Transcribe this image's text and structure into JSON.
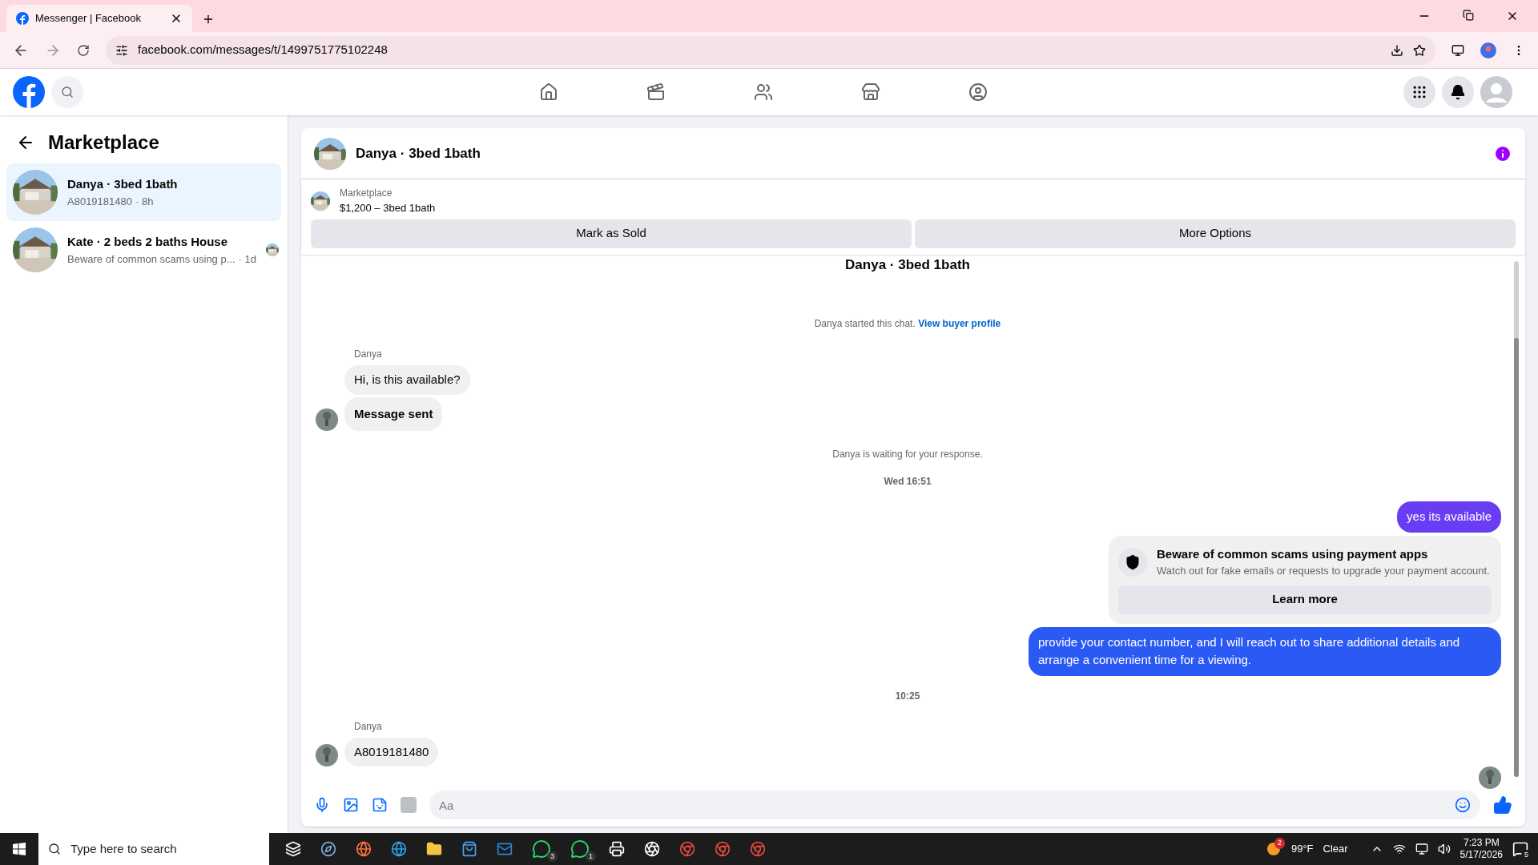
{
  "browser": {
    "tab_title": "Messenger | Facebook",
    "url": "facebook.com/messages/t/1499751775102248"
  },
  "sidebar": {
    "title": "Marketplace",
    "conversations": [
      {
        "name": "Danya · 3bed 1bath",
        "preview": "A8019181480",
        "time": "· 8h",
        "selected": true,
        "seen_avatar": false
      },
      {
        "name": "Kate · 2 beds 2 baths House",
        "preview": "Beware of common scams using p...",
        "time": "· 1d",
        "selected": false,
        "seen_avatar": true
      }
    ]
  },
  "chat": {
    "title": "Danya · 3bed 1bath",
    "listing": {
      "label": "Marketplace",
      "price": "$1,200 – 3bed 1bath"
    },
    "buttons": [
      "Mark as Sold",
      "More Options"
    ],
    "messages": [
      {
        "kind": "title",
        "text": "Danya · 3bed 1bath"
      },
      {
        "kind": "system",
        "text": "Danya started this chat.",
        "link": "View buyer profile"
      },
      {
        "kind": "sender",
        "text": "Danya"
      },
      {
        "kind": "incoming",
        "text": "Hi, is this available?",
        "avatar": false,
        "bold": false
      },
      {
        "kind": "incoming",
        "text": "Message sent",
        "avatar": true,
        "bold": true
      },
      {
        "kind": "system",
        "text": "Danya is waiting for your response."
      },
      {
        "kind": "time",
        "text": "Wed 16:51"
      },
      {
        "kind": "outgoing",
        "text": "yes its available",
        "color": "#6a3df5"
      },
      {
        "kind": "warning",
        "title": "Beware of common scams using payment apps",
        "text": "Watch out for fake emails or requests to upgrade your payment account.",
        "button": "Learn more"
      },
      {
        "kind": "outgoing",
        "text": "provide your contact number, and I will reach out to share additional details and arrange a convenient time for a viewing.",
        "color": "#2b59f4"
      },
      {
        "kind": "time",
        "text": "10:25"
      },
      {
        "kind": "sender",
        "text": "Danya"
      },
      {
        "kind": "incoming",
        "text": "A8019181480",
        "avatar": true,
        "bold": false
      }
    ],
    "composer": {
      "placeholder": "Aa"
    }
  },
  "taskbar": {
    "search_placeholder": "Type here to search",
    "badges": [
      "3",
      "1"
    ],
    "weather_badge": "2",
    "temperature": "99°F",
    "weather": "Clear",
    "time": "7:23 PM",
    "date": "5/17/2026",
    "notifications": "5"
  }
}
